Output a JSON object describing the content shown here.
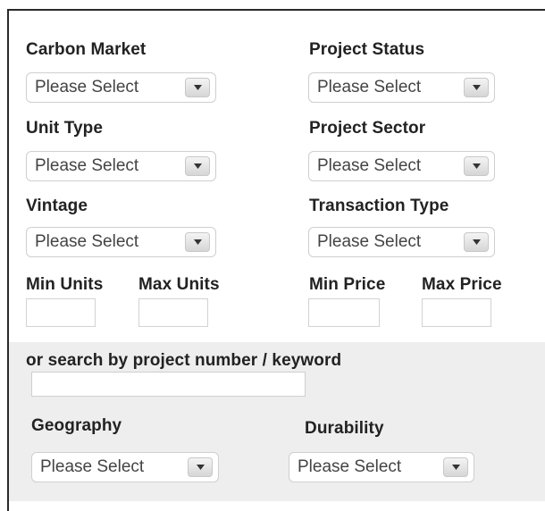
{
  "filters": {
    "carbon_market": {
      "label": "Carbon Market",
      "value": "Please Select"
    },
    "project_status": {
      "label": "Project Status",
      "value": "Please Select"
    },
    "unit_type": {
      "label": "Unit Type",
      "value": "Please Select"
    },
    "project_sector": {
      "label": "Project Sector",
      "value": "Please Select"
    },
    "vintage": {
      "label": "Vintage",
      "value": "Please Select"
    },
    "transaction_type": {
      "label": "Transaction Type",
      "value": "Please Select"
    },
    "min_units": {
      "label": "Min Units",
      "value": ""
    },
    "max_units": {
      "label": "Max Units",
      "value": ""
    },
    "min_price": {
      "label": "Min Price",
      "value": ""
    },
    "max_price": {
      "label": "Max Price",
      "value": ""
    }
  },
  "search": {
    "label": "or search by project number / keyword",
    "value": ""
  },
  "extra_filters": {
    "geography": {
      "label": "Geography",
      "value": "Please Select"
    },
    "durability": {
      "label": "Durability",
      "value": "Please Select"
    }
  },
  "icons": {
    "dropdown": "chevron-down-icon"
  },
  "colors": {
    "lower_band": "#eeeeee",
    "label_text": "#222222"
  }
}
